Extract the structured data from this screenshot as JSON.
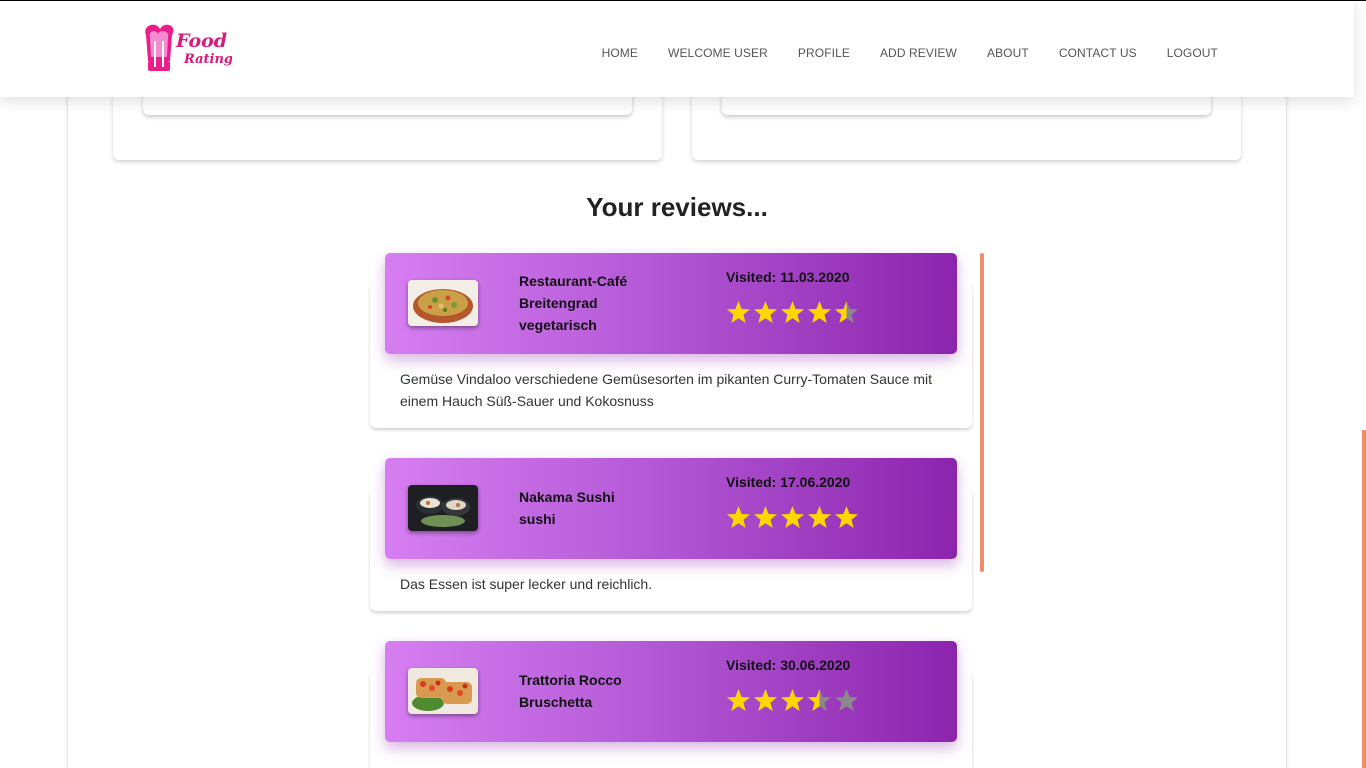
{
  "brand": {
    "logo_line1": "Food",
    "logo_line2": "Rating",
    "accent": "#e91e8c"
  },
  "nav": {
    "items": [
      {
        "label": "HOME"
      },
      {
        "label": "WELCOME USER"
      },
      {
        "label": "PROFILE"
      },
      {
        "label": "ADD REVIEW"
      },
      {
        "label": "ABOUT"
      },
      {
        "label": "CONTACT US"
      },
      {
        "label": "LOGOUT"
      }
    ]
  },
  "section": {
    "title": "Your reviews..."
  },
  "reviews": [
    {
      "name_lines": [
        "Restaurant-Café",
        "Breitengrad",
        "vegetarisch"
      ],
      "visited": "Visited: 11.03.2020",
      "rating": 4.5,
      "text": "Gemüse Vindaloo verschiedene Gemüsesorten im pikanten Curry-Tomaten Sauce mit einem Hauch Süß-Sauer und Kokosnuss",
      "image_icon": "curry-dish-photo"
    },
    {
      "name_lines": [
        "Nakama Sushi",
        "sushi"
      ],
      "visited": "Visited: 17.06.2020",
      "rating": 5,
      "text": "Das Essen ist super lecker und reichlich.",
      "image_icon": "sushi-photo"
    },
    {
      "name_lines": [
        "Trattoria Rocco",
        "Bruschetta"
      ],
      "visited": "Visited: 30.06.2020",
      "rating": 3.5,
      "text": "",
      "image_icon": "bruschetta-photo"
    }
  ],
  "colors": {
    "header_gradient_start": "#d67ef1",
    "header_gradient_end": "#8c24ad",
    "star_filled": "#ffd600",
    "star_empty": "#8a8a8a",
    "timeline": "#ef8f6a"
  }
}
